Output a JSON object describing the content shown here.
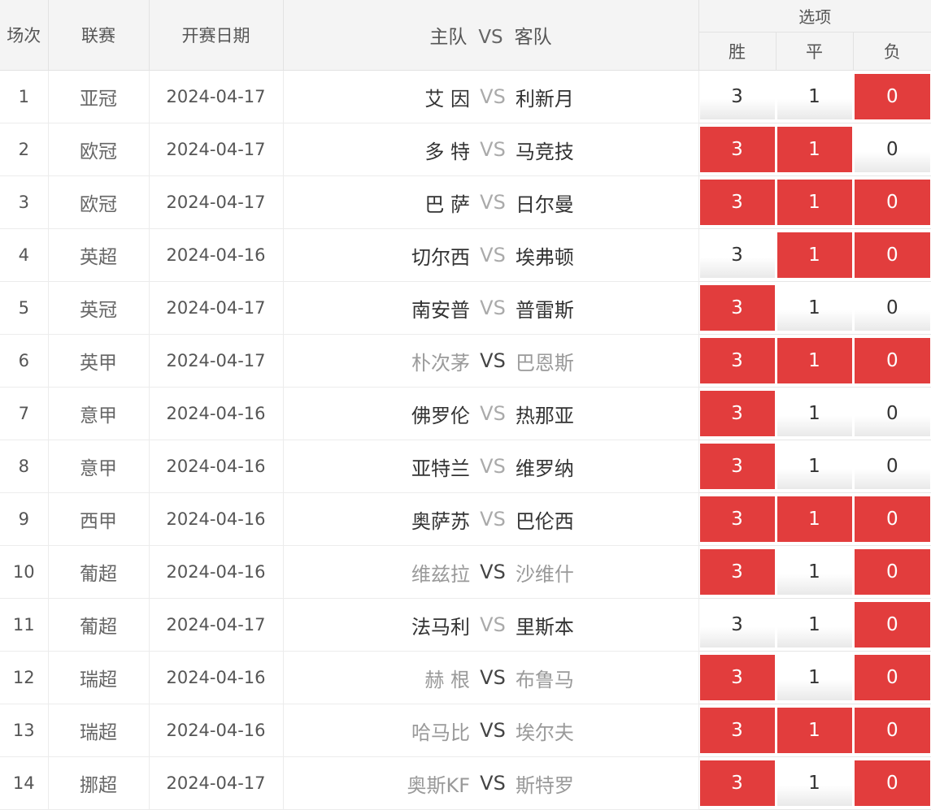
{
  "header": {
    "index": "场次",
    "league": "联赛",
    "date": "开赛日期",
    "home": "主队",
    "vs": "VS",
    "away": "客队",
    "options": "选项",
    "win": "胜",
    "draw": "平",
    "lose": "负"
  },
  "colors": {
    "selected": "#e23d3d",
    "team_dark": "#333333",
    "team_gray": "#9a9a9a"
  },
  "matches": [
    {
      "index": "1",
      "league": "亚冠",
      "date": "2024-04-17",
      "home": "艾 因",
      "vs": "VS",
      "away": "利新月",
      "teams_gray": false,
      "win": "3",
      "draw": "1",
      "lose": "0",
      "sel": [
        false,
        false,
        true
      ]
    },
    {
      "index": "2",
      "league": "欧冠",
      "date": "2024-04-17",
      "home": "多 特",
      "vs": "VS",
      "away": "马竞技",
      "teams_gray": false,
      "win": "3",
      "draw": "1",
      "lose": "0",
      "sel": [
        true,
        true,
        false
      ]
    },
    {
      "index": "3",
      "league": "欧冠",
      "date": "2024-04-17",
      "home": "巴 萨",
      "vs": "VS",
      "away": "日尔曼",
      "teams_gray": false,
      "win": "3",
      "draw": "1",
      "lose": "0",
      "sel": [
        true,
        true,
        true
      ]
    },
    {
      "index": "4",
      "league": "英超",
      "date": "2024-04-16",
      "home": "切尔西",
      "vs": "VS",
      "away": "埃弗顿",
      "teams_gray": false,
      "win": "3",
      "draw": "1",
      "lose": "0",
      "sel": [
        false,
        true,
        true
      ]
    },
    {
      "index": "5",
      "league": "英冠",
      "date": "2024-04-17",
      "home": "南安普",
      "vs": "VS",
      "away": "普雷斯",
      "teams_gray": false,
      "win": "3",
      "draw": "1",
      "lose": "0",
      "sel": [
        true,
        false,
        false
      ]
    },
    {
      "index": "6",
      "league": "英甲",
      "date": "2024-04-17",
      "home": "朴次茅",
      "vs": "VS",
      "away": "巴恩斯",
      "teams_gray": true,
      "win": "3",
      "draw": "1",
      "lose": "0",
      "sel": [
        true,
        true,
        true
      ]
    },
    {
      "index": "7",
      "league": "意甲",
      "date": "2024-04-16",
      "home": "佛罗伦",
      "vs": "VS",
      "away": "热那亚",
      "teams_gray": false,
      "win": "3",
      "draw": "1",
      "lose": "0",
      "sel": [
        true,
        false,
        false
      ]
    },
    {
      "index": "8",
      "league": "意甲",
      "date": "2024-04-16",
      "home": "亚特兰",
      "vs": "VS",
      "away": "维罗纳",
      "teams_gray": false,
      "win": "3",
      "draw": "1",
      "lose": "0",
      "sel": [
        true,
        false,
        false
      ]
    },
    {
      "index": "9",
      "league": "西甲",
      "date": "2024-04-16",
      "home": "奥萨苏",
      "vs": "VS",
      "away": "巴伦西",
      "teams_gray": false,
      "win": "3",
      "draw": "1",
      "lose": "0",
      "sel": [
        true,
        true,
        true
      ]
    },
    {
      "index": "10",
      "league": "葡超",
      "date": "2024-04-16",
      "home": "维兹拉",
      "vs": "VS",
      "away": "沙维什",
      "teams_gray": true,
      "win": "3",
      "draw": "1",
      "lose": "0",
      "sel": [
        true,
        false,
        true
      ]
    },
    {
      "index": "11",
      "league": "葡超",
      "date": "2024-04-17",
      "home": "法马利",
      "vs": "VS",
      "away": "里斯本",
      "teams_gray": false,
      "win": "3",
      "draw": "1",
      "lose": "0",
      "sel": [
        false,
        false,
        true
      ]
    },
    {
      "index": "12",
      "league": "瑞超",
      "date": "2024-04-16",
      "home": "赫 根",
      "vs": "VS",
      "away": "布鲁马",
      "teams_gray": true,
      "win": "3",
      "draw": "1",
      "lose": "0",
      "sel": [
        true,
        false,
        true
      ]
    },
    {
      "index": "13",
      "league": "瑞超",
      "date": "2024-04-16",
      "home": "哈马比",
      "vs": "VS",
      "away": "埃尔夫",
      "teams_gray": true,
      "win": "3",
      "draw": "1",
      "lose": "0",
      "sel": [
        true,
        true,
        true
      ]
    },
    {
      "index": "14",
      "league": "挪超",
      "date": "2024-04-17",
      "home": "奥斯KF",
      "vs": "VS",
      "away": "斯特罗",
      "teams_gray": true,
      "win": "3",
      "draw": "1",
      "lose": "0",
      "sel": [
        true,
        false,
        true
      ]
    }
  ]
}
